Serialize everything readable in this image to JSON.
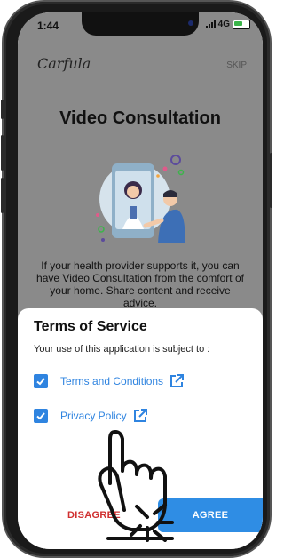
{
  "status_bar": {
    "time": "1:44",
    "network": "4G"
  },
  "app": {
    "logo_text": "Carfula",
    "skip_label": "SKIP"
  },
  "onboarding": {
    "title": "Video Consultation",
    "description": "If your health provider supports it, you can have Video Consultation from the comfort of your home. Share content and receive advice."
  },
  "terms_sheet": {
    "title": "Terms of Service",
    "subtitle": "Your use of this application is subject to :",
    "items": [
      {
        "label": "Terms and Conditions",
        "checked": true
      },
      {
        "label": "Privacy Policy",
        "checked": true
      }
    ],
    "disagree_label": "DISAGREE",
    "agree_label": "AGREE"
  },
  "colors": {
    "accent": "#2f8de4",
    "danger": "#d03030",
    "backdrop": "#8a8a8a"
  },
  "icons": [
    "external-link-icon",
    "check-icon",
    "tap-hand-icon",
    "battery-icon",
    "signal-icon"
  ]
}
